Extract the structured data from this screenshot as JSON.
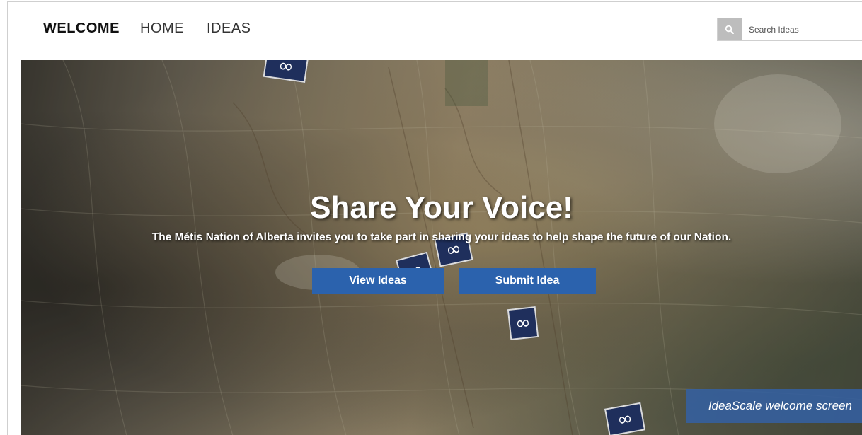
{
  "nav": {
    "items": [
      {
        "label": "WELCOME"
      },
      {
        "label": "HOME"
      },
      {
        "label": "IDEAS"
      }
    ]
  },
  "search": {
    "placeholder": "Search Ideas",
    "icon": "search-icon"
  },
  "hero": {
    "title": "Share Your Voice!",
    "subtitle": "The Métis Nation of Alberta invites you to take part in sharing your ideas to help shape the future of our Nation.",
    "buttons": [
      {
        "label": "View Ideas"
      },
      {
        "label": "Submit Idea"
      }
    ],
    "pin_symbol": "∞",
    "background_description_icon": "map-background"
  },
  "caption": "IdeaScale welcome screen",
  "colors": {
    "button": "#2b62ad",
    "pin": "#1f2f5c",
    "caption": "#3460a0",
    "search_button": "#bdbdbd"
  }
}
